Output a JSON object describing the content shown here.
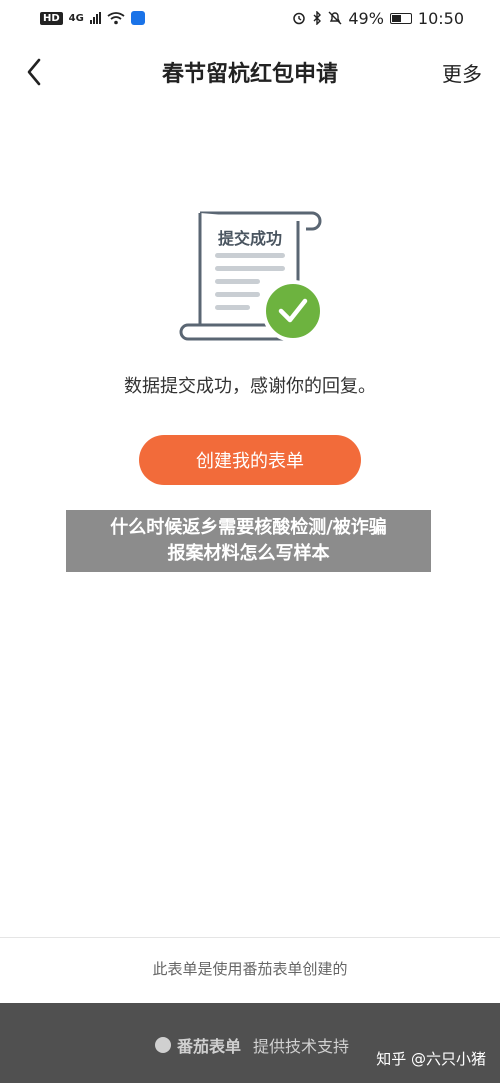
{
  "status_bar": {
    "hd": "HD",
    "network": "4G",
    "battery": "49%",
    "time": "10:50"
  },
  "header": {
    "title": "春节留杭红包申请",
    "more": "更多"
  },
  "illustration": {
    "doc_title": "提交成功"
  },
  "message": "数据提交成功，感谢你的回复。",
  "create_button": "创建我的表单",
  "overlay": {
    "line1": "什么时候返乡需要核酸检测/被诈骗",
    "line2": "报案材料怎么写样本"
  },
  "footer": {
    "note": "此表单是使用番茄表单创建的",
    "brand": "番茄表单",
    "tagline": "提供技术支持",
    "watermark": "知乎 @六只小猪"
  },
  "colors": {
    "accent": "#f26b3a",
    "success": "#6db33f"
  }
}
